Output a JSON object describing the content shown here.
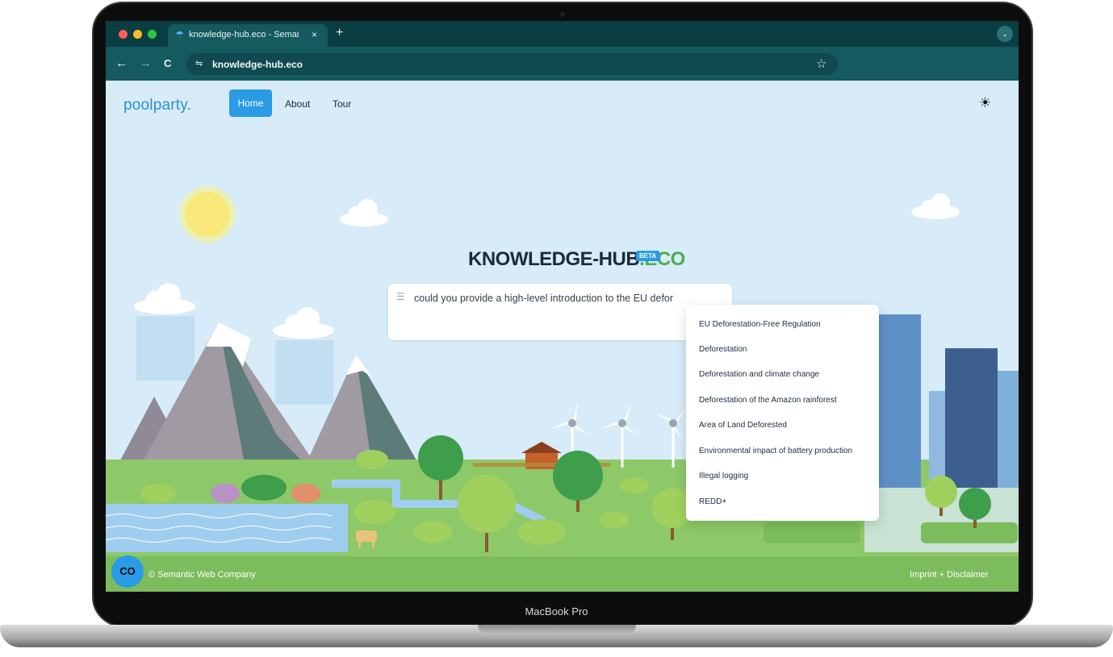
{
  "device": {
    "label": "MacBook Pro"
  },
  "browser": {
    "tab": {
      "title": "knowledge-hub.eco - Semantic",
      "close": "×"
    },
    "new_tab": "+",
    "menu": "⌄",
    "nav": {
      "back": "←",
      "forward": "→",
      "reload": "C"
    },
    "address": {
      "url": "knowledge-hub.eco",
      "site_icon": "⇋",
      "bookmark": "☆"
    }
  },
  "page": {
    "logo": {
      "text_pool": "pool",
      "text_party": "party",
      "dot": "."
    },
    "nav": [
      {
        "label": "Home",
        "active": true
      },
      {
        "label": "About"
      },
      {
        "label": "Tour"
      }
    ],
    "theme_toggle_icon": "☀",
    "hero": {
      "title_main": "KNOWLEDGE-HUB",
      "title_suffix": ".ECO",
      "badge": "BETA"
    },
    "search": {
      "icon": "☰",
      "value": "could you provide a high-level introduction to the EU defor"
    },
    "suggestions": [
      "EU Deforestation-Free Regulation",
      "Deforestation",
      "Deforestation and climate change",
      "Deforestation of the Amazon rainforest",
      "Area of Land Deforested",
      "Environmental impact of battery production",
      "Illegal logging",
      "REDD+"
    ],
    "footer": {
      "copyright": "© Semantic Web Company",
      "links": "Imprint + Disclaimer"
    },
    "badge": {
      "text": "CO"
    }
  },
  "colors": {
    "accent": "#2a9be4",
    "eco_green": "#4cae4c",
    "tab_bar": "#0b3e42",
    "toolbar": "#145a5f"
  }
}
